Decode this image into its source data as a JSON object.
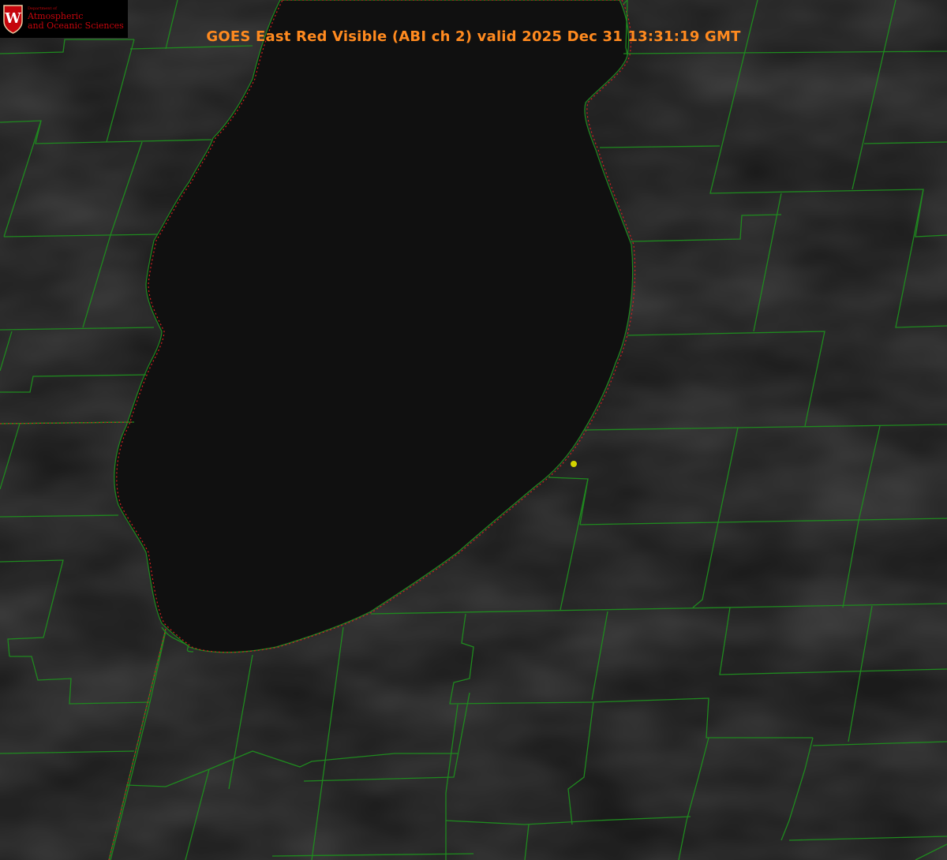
{
  "title": "GOES East Red Visible (ABI ch 2) valid 2025 Dec 31 13:31:19 GMT",
  "logo": {
    "dept": "Department of",
    "line1": "Atmospheric",
    "line2": "and Oceanic Sciences",
    "badge": "W"
  },
  "colors": {
    "background": "#141414",
    "lake": "#0f0f0f",
    "county_lines": "#1f8a1f",
    "shoreline_dots": "#d42020",
    "title": "#ff8a1f",
    "logo_text": "#c5050c",
    "marker": "#d4d400"
  },
  "icons": [
    "uw-crest-icon",
    "station-marker-icon"
  ]
}
